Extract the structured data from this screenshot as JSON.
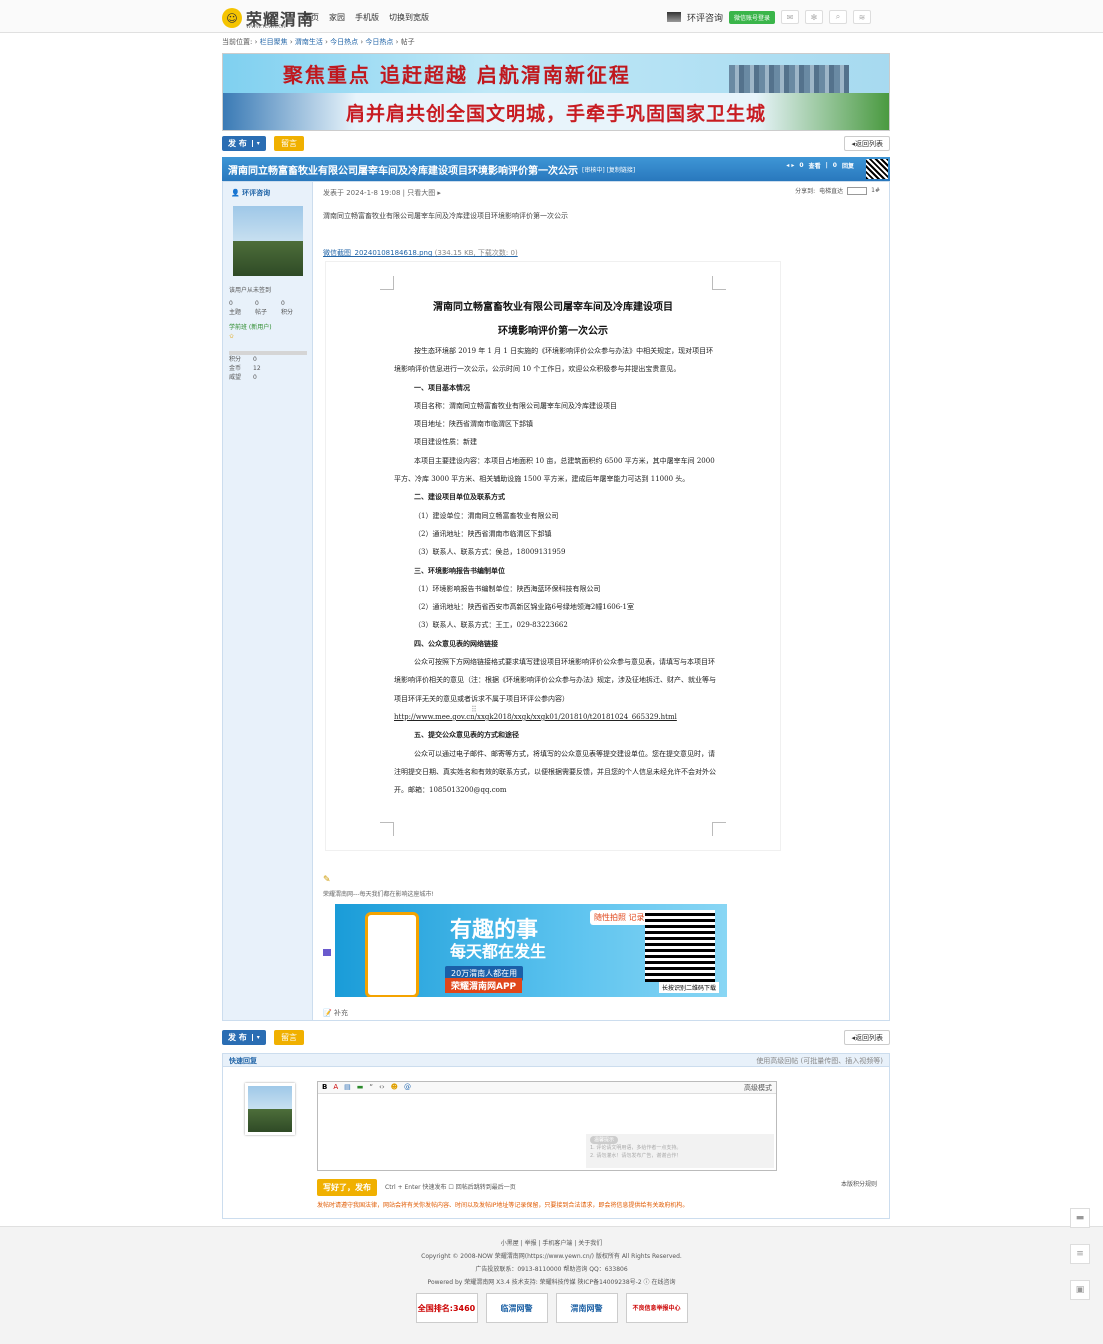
{
  "site": {
    "logo_text": "荣耀渭南",
    "logo_sub": "WWW.YEWN.CN",
    "logo_face": "☺"
  },
  "topnav": [
    "首页",
    "家园",
    "手机版",
    "切换到宽版"
  ],
  "topright": {
    "label": "环评咨询",
    "login": "微信账号登录",
    "icons": [
      "mail-icon",
      "gear-icon",
      "search-icon",
      "rss-icon"
    ]
  },
  "breadcrumb": {
    "prefix": "当前位置:",
    "items": [
      "栏目聚焦",
      "渭南生活",
      "今日热点",
      "今日热点",
      "帖子"
    ]
  },
  "banner": {
    "line1": "聚焦重点 追赶超越 启航渭南新征程",
    "line2": "肩并肩共创全国文明城，手牵手巩固国家卫生城"
  },
  "actions": {
    "post": "发 布",
    "message": "留言",
    "back": "◂返回列表"
  },
  "thread": {
    "title": "渭南同立畅富畜牧业有限公司屠宰车间及冷库建设项目环境影响评价第一次公示",
    "tags": "[审核中] [复制链接]",
    "stats": {
      "views": "0",
      "views_label": "查看",
      "replies": "0",
      "replies_label": "回复"
    }
  },
  "author": {
    "name": "环评咨询",
    "checkin": "该用户从未签到",
    "counts": [
      {
        "v": "0",
        "l": "主题"
      },
      {
        "v": "0",
        "l": "帖子"
      },
      {
        "v": "0",
        "l": "积分"
      }
    ],
    "level": "学前班 (新用户)",
    "star": "✩",
    "kv": [
      {
        "k": "积分",
        "v": "0"
      },
      {
        "k": "金币",
        "v": "12"
      },
      {
        "k": "威望",
        "v": "0"
      }
    ]
  },
  "post": {
    "meta": "发表于 2024-1-8 19:08 | 只看大图 ▸",
    "share_label": "分享到:",
    "share_item": "电梯直达",
    "floor": "1#",
    "intro": "渭南同立畅富畜牧业有限公司屠宰车间及冷库建设项目环境影响评价第一次公示",
    "attachment": "微信截图_20240108184618.png",
    "attachment_size": "(334.15 KB, 下载次数: 0)"
  },
  "doc": {
    "title1": "渭南同立畅富畜牧业有限公司屠宰车间及冷库建设项目",
    "title2": "环境影响评价第一次公示",
    "lines": [
      {
        "c": "p",
        "t": "按生态环境部 2019 年 1 月 1 日实施的《环境影响评价公众参与办法》中相关规定，现对项目环境影响评价信息进行一次公示，公示时间 10 个工作日，欢迎公众积极参与并提出宝贵意见。"
      },
      {
        "c": "h",
        "t": "一、项目基本情况"
      },
      {
        "c": "i",
        "t": "项目名称：渭南同立畅富畜牧业有限公司屠宰车间及冷库建设项目"
      },
      {
        "c": "i",
        "t": "项目地址：陕西省渭南市临渭区下邽镇"
      },
      {
        "c": "i",
        "t": "项目建设性质：新建"
      },
      {
        "c": "p",
        "t": "本项目主要建设内容：本项目占地面积 10 亩，总建筑面积约 6500 平方米，其中屠宰车间 2000 平方、冷库 3000 平方米、相关辅助设施 1500 平方米，建成后年屠宰能力可达到 11000 头。"
      },
      {
        "c": "h",
        "t": "二、建设项目单位及联系方式"
      },
      {
        "c": "i",
        "t": "（1）建设单位：渭南同立畅富畜牧业有限公司"
      },
      {
        "c": "i",
        "t": "（2）通讯地址：陕西省渭南市临渭区下邽镇"
      },
      {
        "c": "i",
        "t": "（3）联系人、联系方式：侯总，18009131959"
      },
      {
        "c": "h",
        "t": "三、环境影响报告书编制单位"
      },
      {
        "c": "i",
        "t": "（1）环境影响报告书编制单位：陕西海蓝环保科技有限公司"
      },
      {
        "c": "i",
        "t": "（2）通讯地址：陕西省西安市高新区锦业路6号绿地领海2幢1606-1室"
      },
      {
        "c": "i",
        "t": "（3）联系人、联系方式：王工，029-83223662"
      },
      {
        "c": "h",
        "t": "四、公众意见表的网络链接"
      },
      {
        "c": "p",
        "t": "公众可按照下方网络链接格式要求填写建设项目环境影响评价公众参与意见表，请填写与本项目环境影响评价相关的意见（注：根据《环境影响评价公众参与办法》规定，涉及征地拆迁、财产、就业等与项目环评无关的意见或者诉求不属于项目环评公参内容）"
      },
      {
        "c": "u",
        "t": "http://www.mee.gov.cn/xxgk2018/xxgk/xxgk01/201810/t20181024_665329.html"
      },
      {
        "c": "h",
        "t": "五、提交公众意见表的方式和途径"
      },
      {
        "c": "p",
        "t": "公众可以通过电子邮件、邮寄等方式，将填写的公众意见表等提交建设单位。您在提交意见时，请注明提交日期、真实姓名和有效的联系方式，以便根据需要反馈，并且您的个人信息未经允许不会对外公开。邮箱：1085013200@qq.com"
      }
    ]
  },
  "signature": "荣耀渭南网---每天我们都在影响这座城市!",
  "ad": {
    "line1": "有趣的事",
    "line2": "每天都在发生",
    "line3": "20万渭南人都在用",
    "line4": "荣耀渭南网APP",
    "tag": "随性拍照 记录品质生活",
    "qr_label": "长按识别二维码下载"
  },
  "supplement": "补充",
  "quick_reply": {
    "title": "快速回复",
    "right": "使用高级回帖 (可批量传图、插入视频等)",
    "toolbar": [
      "B",
      "A",
      "▤",
      "▬",
      "“",
      "‹›",
      "☻",
      "@"
    ],
    "advanced": "高级模式",
    "hint_title": "温馨提示",
    "hint1": "1. 评论请文明用语，多给作者一点支持。",
    "hint2": "2. 请勿灌水！请勿发布广告，谢谢合作！",
    "submit": "写好了，发布",
    "submit_hint": "Ctrl + Enter 快速发布  ☐ 回帖后跳转到最后一页",
    "rules": "本版积分规则",
    "warning": "发帖时请遵守我国法律，网站会将有关你发帖内容、时间以及发帖IP地址等记录保留，只要接到合法请求，即会将信息提供给有关政府机构。"
  },
  "footer": {
    "links": "小黑屋 | 举报 | 手机客户端 | 关于我们",
    "copyright": "Copyright © 2008-NOW 荣耀渭南网(https://www.yewn.cn/) 版权所有 All Rights Reserved.",
    "contact": "广告投放联系：0913-8110000 帮助咨询 QQ：633806",
    "powered": "Powered by 荣耀渭南网 X3.4  技术支持: 荣耀科技传媒 陕ICP备14009238号-2  ⓘ 在线咨询",
    "badges": [
      "全国排名:3460",
      "临渭网警",
      "渭南网警",
      "不良信息举报中心"
    ]
  },
  "floating": [
    "chat-icon",
    "list-icon",
    "calendar-icon"
  ]
}
